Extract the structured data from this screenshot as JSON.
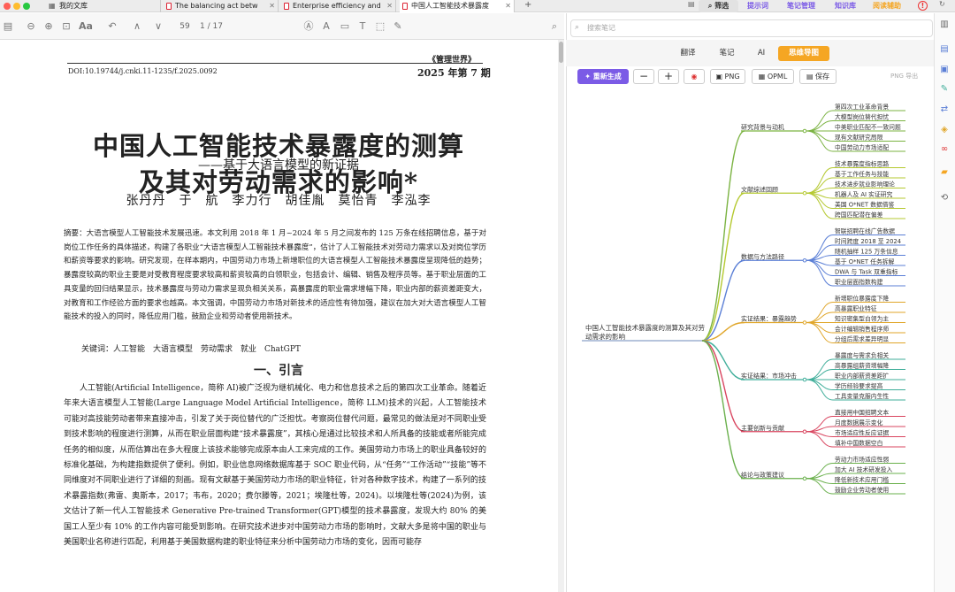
{
  "tabs": [
    {
      "label": "我的文库"
    },
    {
      "label": "The balancing act betw"
    },
    {
      "label": "Enterprise efficiency and"
    },
    {
      "label": "中国人工智能技术暴露度"
    }
  ],
  "top_right": {
    "filter": "筛选",
    "prompt": "提示词",
    "notes_manage": "笔记管理",
    "kb": "知识库",
    "reading_aid": "阅读辅助"
  },
  "reader": {
    "page": "59",
    "total": "1 / 17"
  },
  "paper": {
    "journal": "《管理世界》",
    "doi": "DOI:10.19744/j.cnki.11-1235/f.2025.0092",
    "issue": "2025 年第 7 期",
    "title1": "中国人工智能技术暴露度的测算",
    "title2": "及其对劳动需求的影响*",
    "subtitle": "——基于大语言模型的新证据",
    "authors": "张丹丹　于　航　李力行　胡佳胤　莫怡青　李泓李",
    "abstract": "摘要：大语言模型人工智能技术发展迅速。本文利用 2018 年 1 月~2024 年 5 月之间发布的 125 万条在线招聘信息，基于对岗位工作任务的具体描述，构建了各职业“大语言模型人工智能技术暴露度”，估计了人工智能技术对劳动力需求以及对岗位学历和薪资等要求的影响。研究发现，在样本期内，中国劳动力市场上新增职位的大语言模型人工智能技术暴露度呈现降低的趋势；暴露度较高的职业主要是对受教育程度要求较高和薪资较高的白领职业，包括会计、编辑、销售及程序员等。基于职业层面的工具变量的回归结果显示，技术暴露度与劳动力需求呈现负相关关系，高暴露度的职业需求增幅下降，职业内部的薪资差距变大，对教育和工作经验方面的要求也越高。本文强调，中国劳动力市场对新技术的适应性有待加强，建议在加大对大语言模型人工智能技术的投入的同时，降低应用门槛，鼓励企业和劳动者使用新技术。",
    "keywords": "关键词：人工智能　大语言模型　劳动需求　就业　ChatGPT",
    "section": "一、引言",
    "intro": "人工智能(Artificial Intelligence，简称 AI)被广泛视为继机械化、电力和信息技术之后的第四次工业革命。随着近年来大语言模型人工智能(Large Language Model Artificial Intelligence，简称 LLM)技术的兴起，人工智能技术可能对高技能劳动者带来直接冲击，引发了关于岗位替代的广泛担忧。考察岗位替代问题，最常见的做法是对不同职业受到技术影响的程度进行测算，从而在职业层面构建“技术暴露度”，其核心是通过比较技术和人所具备的技能或者所能完成任务的相似度，从而估算出在多大程度上该技术能够完成原本由人工来完成的工作。美国劳动力市场上的职业具备较好的标准化基础，为构建指数提供了便利。例如，职业信息网络数据库基于 SOC 职业代码，从“任务”“工作活动”“技能”等不同维度对不同职业进行了详细的刻画。现有文献基于美国劳动力市场的职业特征，针对各种数字技术，构建了一系列的技术暴露指数(弗雷、奥斯本，2017；韦布，2020；费尔滕等，2021；埃隆杜等，2024)。以埃隆杜等(2024)为例，该文估计了新一代人工智能技术 Generative Pre-trained Transformer(GPT)模型的技术暴露度，发现大约 80% 的美国工人至少有 10% 的工作内容可能受到影响。在研究技术进步对中国劳动力市场的影响时，文献大多是将中国的职业与美国职业名称进行匹配，利用基于美国数据构建的职业特征来分析中国劳动力市场的变化，因而可能存"
  },
  "notes": {
    "search_placeholder": "搜索笔记",
    "tabs": [
      "翻译",
      "笔记",
      "AI",
      "思维导图"
    ],
    "tools": {
      "regen": "重新生成",
      "minus": "−",
      "plus": "+",
      "png": "PNG",
      "opml": "OPML",
      "save": "保存",
      "export": "PNG 导出"
    }
  },
  "mindmap": {
    "root": "中国人工智能技术暴露度的测算及其对劳动需求的影响",
    "branches": [
      {
        "label": "研究背景与动机",
        "color": "#7bb342",
        "children": [
          "第四次工业革命背景",
          "大模型岗位替代担忧",
          "中美职业匹配不一致问题",
          "现有文献研究局限",
          "中国劳动力市场适配"
        ]
      },
      {
        "label": "文献综述回顾",
        "color": "#b5c930",
        "children": [
          "技术暴露度指标思路",
          "基于工作任务与技能",
          "技术进步就业影响理论",
          "机器人及 AI 实证研究",
          "美国 O*NET 数据借鉴",
          "跨国匹配潜在偏差"
        ]
      },
      {
        "label": "数据与方法路径",
        "color": "#5b7fd6",
        "children": [
          "智联招聘在线广告数据",
          "时间跨度 2018 至 2024",
          "随机抽样 125 万条信息",
          "基于 O*NET 任务拆解",
          "DWA 与 Task 双重指标",
          "职业层面指数构建"
        ]
      },
      {
        "label": "实证结果：暴露趋势",
        "color": "#e0a62a",
        "children": [
          "新增职位暴露度下降",
          "高暴露职业特征",
          "知识密集型白领为主",
          "会计编辑销售程序师",
          "分组后需求差异明显"
        ]
      },
      {
        "label": "实证结果：市场冲击",
        "color": "#3fae9a",
        "children": [
          "暴露度与需求负相关",
          "高暴露组薪资增幅降",
          "职业内部薪资差距扩",
          "学历经验要求提高",
          "工具变量克服内生性"
        ]
      },
      {
        "label": "主要创新与贡献",
        "color": "#d9455f",
        "children": [
          "直接用中国招聘文本",
          "月度数据展示变化",
          "市场适应性反应证据",
          "填补中国数据空白"
        ]
      },
      {
        "label": "结论与政策建议",
        "color": "#6ab04c",
        "children": [
          "劳动力市场适应性弱",
          "加大 AI 技术研发投入",
          "降低新技术应用门槛",
          "鼓励企业劳动者使用"
        ]
      }
    ]
  }
}
